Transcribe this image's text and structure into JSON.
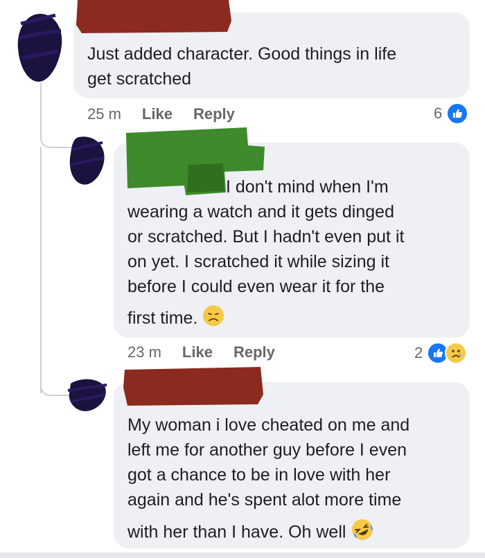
{
  "comments": [
    {
      "text_line1": "Just added character. Good things in life",
      "text_line2": "get scratched",
      "time": "25 m",
      "like_label": "Like",
      "reply_label": "Reply",
      "reaction_count": "6",
      "reactions": [
        "like-icon"
      ]
    },
    {
      "text_line1": "I don't mind when I'm",
      "text_line2": "wearing a watch and it gets dinged",
      "text_line3": "or scratched. But I hadn't even put it",
      "text_line4": "on yet. I scratched it while sizing it",
      "text_line5": "before I could even wear it for the",
      "text_line6": "first time.",
      "time": "23 m",
      "like_label": "Like",
      "reply_label": "Reply",
      "reaction_count": "2",
      "reactions": [
        "like-icon",
        "sad-icon"
      ]
    },
    {
      "text_line1": "My woman i love cheated on me and",
      "text_line2": "left me for another guy before I even",
      "text_line3": "got a chance to be in love with her",
      "text_line4": "again and he's spent alot more time",
      "text_line5": "with her than I have. Oh well"
    }
  ],
  "colors": {
    "bubble": "#eef0f3",
    "like_blue": "#1877f2",
    "meta_gray": "#65676b",
    "redact_red": "#8b2a1f",
    "redact_green": "#3f8a2c",
    "avatar_scribble": "#1c1240"
  }
}
